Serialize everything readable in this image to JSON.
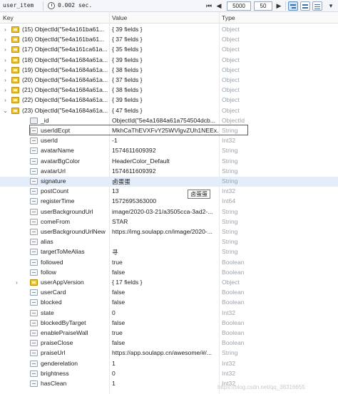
{
  "toolbar": {
    "collection": "user_item",
    "time": "0.002 sec.",
    "limit": "5000",
    "skip": "50"
  },
  "header": {
    "key": "Key",
    "value": "Value",
    "type": "Type"
  },
  "rows": [
    {
      "level": 0,
      "expander": "right",
      "icon": "obj",
      "key": "(15) ObjectId(\"5e4a161ba61...",
      "value": "{ 39 fields }",
      "type": "Object"
    },
    {
      "level": 0,
      "expander": "right",
      "icon": "obj",
      "key": "(16) ObjectId(\"5e4a161ba61...",
      "value": "{ 37 fields }",
      "type": "Object"
    },
    {
      "level": 0,
      "expander": "right",
      "icon": "obj",
      "key": "(17) ObjectId(\"5e4a161ca61a...",
      "value": "{ 35 fields }",
      "type": "Object"
    },
    {
      "level": 0,
      "expander": "right",
      "icon": "obj",
      "key": "(18) ObjectId(\"5e4a1684a61a...",
      "value": "{ 39 fields }",
      "type": "Object"
    },
    {
      "level": 0,
      "expander": "right",
      "icon": "obj",
      "key": "(19) ObjectId(\"5e4a1684a61a...",
      "value": "{ 38 fields }",
      "type": "Object"
    },
    {
      "level": 0,
      "expander": "right",
      "icon": "obj",
      "key": "(20) ObjectId(\"5e4a1684a61a...",
      "value": "{ 37 fields }",
      "type": "Object"
    },
    {
      "level": 0,
      "expander": "right",
      "icon": "obj",
      "key": "(21) ObjectId(\"5e4a1684a61a...",
      "value": "{ 38 fields }",
      "type": "Object"
    },
    {
      "level": 0,
      "expander": "right",
      "icon": "obj",
      "key": "(22) ObjectId(\"5e4a1684a61a...",
      "value": "{ 39 fields }",
      "type": "Object"
    },
    {
      "level": 0,
      "expander": "down",
      "icon": "obj",
      "key": "(23) ObjectId(\"5e4a1684a61a...",
      "value": "{ 47 fields }",
      "type": "Object"
    },
    {
      "level": 1,
      "expander": "",
      "icon": "oid",
      "key": "_id",
      "value": "ObjectId(\"5e4a1684a61a754504dcb...",
      "type": "ObjectId"
    },
    {
      "level": 1,
      "expander": "",
      "icon": "fld",
      "key": "userIdEcpt",
      "value": "MkhCaThEVXFvY25WVlgvZUh1NEEx...",
      "type": "String"
    },
    {
      "level": 1,
      "expander": "",
      "icon": "fld",
      "key": "userId",
      "value": "-1",
      "type": "Int32"
    },
    {
      "level": 1,
      "expander": "",
      "icon": "fld",
      "key": "avatarName",
      "value": "1574611609392",
      "type": "String"
    },
    {
      "level": 1,
      "expander": "",
      "icon": "fld",
      "key": "avatarBgColor",
      "value": "HeaderColor_Default",
      "type": "String"
    },
    {
      "level": 1,
      "expander": "",
      "icon": "fld",
      "key": "avatarUrl",
      "value": "1574611609392",
      "type": "String"
    },
    {
      "level": 1,
      "expander": "",
      "icon": "fld",
      "key": "signature",
      "value": "卤蛋蛋",
      "type": "String",
      "selected": true
    },
    {
      "level": 1,
      "expander": "",
      "icon": "fld",
      "key": "postCount",
      "value": "13",
      "type": "Int32"
    },
    {
      "level": 1,
      "expander": "",
      "icon": "fld",
      "key": "registerTime",
      "value": "1572695363000",
      "type": "Int64"
    },
    {
      "level": 1,
      "expander": "",
      "icon": "fld",
      "key": "userBackgroundUrl",
      "value": "image/2020-03-21/a3505cca-3ad2-...",
      "type": "String"
    },
    {
      "level": 1,
      "expander": "",
      "icon": "fld",
      "key": "comeFrom",
      "value": "STAR",
      "type": "String"
    },
    {
      "level": 1,
      "expander": "",
      "icon": "fld",
      "key": "userBackgroundUrlNew",
      "value": "https://img.soulapp.cn/image/2020-...",
      "type": "String"
    },
    {
      "level": 1,
      "expander": "",
      "icon": "fld",
      "key": "alias",
      "value": "",
      "type": "String"
    },
    {
      "level": 1,
      "expander": "",
      "icon": "fld",
      "key": "targetToMeAlias",
      "value": "寻",
      "type": "String"
    },
    {
      "level": 1,
      "expander": "",
      "icon": "fld",
      "key": "followed",
      "value": "true",
      "type": "Boolean"
    },
    {
      "level": 1,
      "expander": "",
      "icon": "fld",
      "key": "follow",
      "value": "false",
      "type": "Boolean"
    },
    {
      "level": 1,
      "expander": "right",
      "icon": "obj",
      "key": "userAppVersion",
      "value": "{ 17 fields }",
      "type": "Object"
    },
    {
      "level": 1,
      "expander": "",
      "icon": "fld",
      "key": "userCard",
      "value": "false",
      "type": "Boolean"
    },
    {
      "level": 1,
      "expander": "",
      "icon": "fld",
      "key": "blocked",
      "value": "false",
      "type": "Boolean"
    },
    {
      "level": 1,
      "expander": "",
      "icon": "fld",
      "key": "state",
      "value": "0",
      "type": "Int32"
    },
    {
      "level": 1,
      "expander": "",
      "icon": "fld",
      "key": "blockedByTarget",
      "value": "false",
      "type": "Boolean"
    },
    {
      "level": 1,
      "expander": "",
      "icon": "fld",
      "key": "enablePraiseWall",
      "value": "true",
      "type": "Boolean"
    },
    {
      "level": 1,
      "expander": "",
      "icon": "fld",
      "key": "praiseClose",
      "value": "false",
      "type": "Boolean"
    },
    {
      "level": 1,
      "expander": "",
      "icon": "fld",
      "key": "praiseUrl",
      "value": "https://app.soulapp.cn/awesome/#/...",
      "type": "String"
    },
    {
      "level": 1,
      "expander": "",
      "icon": "fld",
      "key": "genderelation",
      "value": "1",
      "type": "Int32"
    },
    {
      "level": 1,
      "expander": "",
      "icon": "fld",
      "key": "brightness",
      "value": "0",
      "type": "Int32"
    },
    {
      "level": 1,
      "expander": "",
      "icon": "fld",
      "key": "hasClean",
      "value": "1",
      "type": "Int32"
    }
  ],
  "tooltip": "卤蛋蛋",
  "watermark": "https://blog.csdn.net/qq_38316655"
}
